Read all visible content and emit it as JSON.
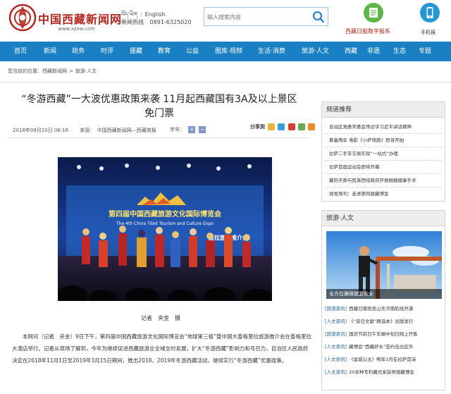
{
  "header": {
    "logo_text": "中国西藏新闻网",
    "logo_url": "www.xzxw.com",
    "lang_tibetan": "བོད་ཡིག",
    "lang_english": "English",
    "hotline_label": "新闻热线",
    "hotline_number": "0891-6325020",
    "search_placeholder": "输入搜索内容",
    "epaper_label": "西藏日报数字报系",
    "mobile_label": "手机报"
  },
  "nav": {
    "items": [
      "首页",
      "新闻",
      "政务",
      "时评",
      "援藏",
      "教育",
      "公益",
      "图库·视频",
      "生活·消费",
      "旅游·人文",
      "西藏",
      "非遗",
      "生态",
      "专题"
    ]
  },
  "breadcrumb": {
    "prefix": "您当前的位置：",
    "items": [
      "西藏新闻网",
      "旅游·人文"
    ],
    "sep": ">"
  },
  "article": {
    "title": "“冬游西藏”一大波优惠政策来袭 11月起西藏国有3A及以上景区免门票",
    "date": "2018年09月10日 08:16",
    "source": "来源：　中国西藏新闻网—西藏商报",
    "font_size_label": "字号：",
    "font_plus": "+",
    "font_minus": "−",
    "share_label": "分享到",
    "photo_banner_title": "第四届中国西藏旅游文化国际博览会",
    "photo_banner_sub": "The 4th China Tibet Tourism and Culture Expo",
    "photo_side_text": "里拉旅游推介会",
    "caption": "记者　央金　摄",
    "body": "本网讯（记者　央金）9日下午，第四届中国西藏旅游文化国际博览会“地球第三极”暨中国大香格里拉旅游推介会在香格里拉大酒店举行。记者从现场了解到，今年为继续促进西藏旅游业全域全时发展，扩大“冬游西藏”影响力和号召力，自治区人民政府决定在2018年11月1日至2019年3月15日期间，推出2018、2019年冬游西藏活动，继续实行“冬游西藏”优惠政策。"
  },
  "sidebar": {
    "recommend_title": "频道推荐",
    "recommend_items": [
      "自治区党委常委会传达学习近平讲话精神",
      "筹备两年 电影《小萨快跑》即将开拍",
      "拉萨二手车交易实现“一站式”办理",
      "拉萨首届运动会即将开幕",
      "藏历天葬与民族团结政府开展婚姻健康手术",
      "视觉周刊：走进第四届藏博会"
    ],
    "tourism_title": "旅游·人文",
    "tourism_photo_caption": "全方位确保旅游安全",
    "tourism_items": [
      {
        "tag": "[旅游资讯]",
        "text": "西藏日喀则至山东济南航线开通"
      },
      {
        "tag": "[人文资讯]",
        "text": "《“普日文献”精选本》出版发行"
      },
      {
        "tag": "[旅游资讯]",
        "text": "国庆节前日午车厢中旬日网上开售"
      },
      {
        "tag": "[人文资讯]",
        "text": "藏博会“西藏好水”签约击出区外"
      },
      {
        "tag": "[人文资讯]",
        "text": "《金城公主》明年1月在拉萨首演"
      },
      {
        "tag": "[人文资讯]",
        "text": "20余种专利藏式家装亮相藏博会"
      }
    ]
  },
  "colors": {
    "nav_bg": "#1a80c4",
    "brand_red": "#b3261e",
    "epaper_green": "#5cb548",
    "mobile_blue": "#2796d6"
  }
}
